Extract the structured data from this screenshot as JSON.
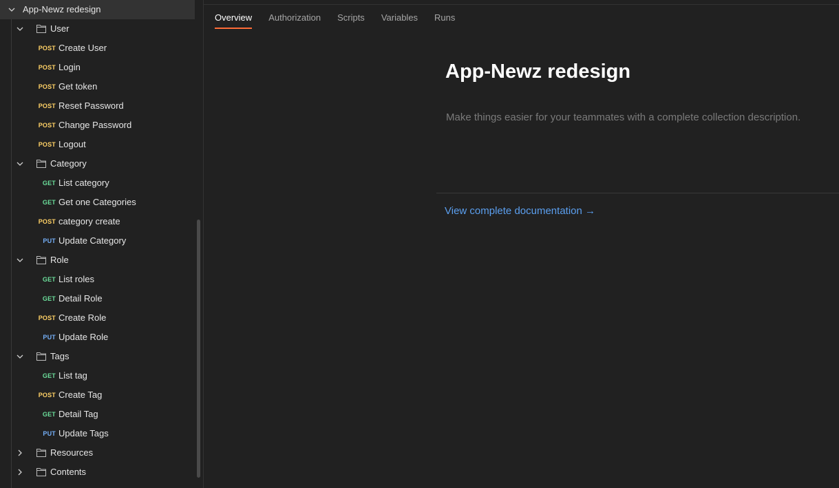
{
  "sidebar": {
    "collection_name": "App-Newz redesign",
    "items": [
      {
        "type": "folder",
        "label": "User",
        "expanded": true
      },
      {
        "type": "request",
        "method": "POST",
        "label": "Create User"
      },
      {
        "type": "request",
        "method": "POST",
        "label": "Login"
      },
      {
        "type": "request",
        "method": "POST",
        "label": "Get token"
      },
      {
        "type": "request",
        "method": "POST",
        "label": "Reset Password"
      },
      {
        "type": "request",
        "method": "POST",
        "label": "Change Password"
      },
      {
        "type": "request",
        "method": "POST",
        "label": "Logout"
      },
      {
        "type": "folder",
        "label": "Category",
        "expanded": true
      },
      {
        "type": "request",
        "method": "GET",
        "label": "List category"
      },
      {
        "type": "request",
        "method": "GET",
        "label": "Get one Categories"
      },
      {
        "type": "request",
        "method": "POST",
        "label": "category create"
      },
      {
        "type": "request",
        "method": "PUT",
        "label": "Update Category"
      },
      {
        "type": "folder",
        "label": "Role",
        "expanded": true
      },
      {
        "type": "request",
        "method": "GET",
        "label": "List roles"
      },
      {
        "type": "request",
        "method": "GET",
        "label": "Detail Role"
      },
      {
        "type": "request",
        "method": "POST",
        "label": "Create Role"
      },
      {
        "type": "request",
        "method": "PUT",
        "label": "Update Role"
      },
      {
        "type": "folder",
        "label": "Tags",
        "expanded": true
      },
      {
        "type": "request",
        "method": "GET",
        "label": "List tag"
      },
      {
        "type": "request",
        "method": "POST",
        "label": "Create Tag"
      },
      {
        "type": "request",
        "method": "GET",
        "label": "Detail Tag"
      },
      {
        "type": "request",
        "method": "PUT",
        "label": "Update Tags"
      },
      {
        "type": "folder",
        "label": "Resources",
        "expanded": false
      },
      {
        "type": "folder",
        "label": "Contents",
        "expanded": false
      }
    ]
  },
  "main": {
    "tabs": [
      {
        "label": "Overview",
        "active": true
      },
      {
        "label": "Authorization",
        "active": false
      },
      {
        "label": "Scripts",
        "active": false
      },
      {
        "label": "Variables",
        "active": false
      },
      {
        "label": "Runs",
        "active": false
      }
    ],
    "title": "App-Newz redesign",
    "description_placeholder": "Make things easier for your teammates with a complete collection description.",
    "doc_link": "View complete documentation →"
  },
  "colors": {
    "accent": "#ff6c37",
    "post": "#ffd166",
    "get": "#6bdd9a",
    "put": "#74aef6",
    "link": "#5b9fef"
  }
}
